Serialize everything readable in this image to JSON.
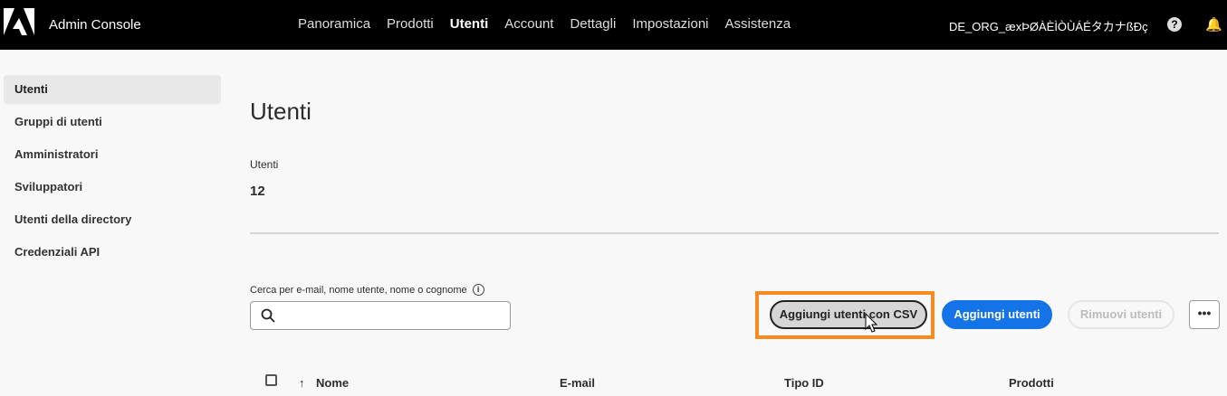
{
  "header": {
    "app_name": "Admin Console",
    "nav": [
      "Panoramica",
      "Prodotti",
      "Utenti",
      "Account",
      "Dettagli",
      "Impostazioni",
      "Assistenza"
    ],
    "active_nav": "Utenti",
    "org": "DE_ORG_æxÞØÀÈÌÒÙÁÉタカナßÐç"
  },
  "sidebar": {
    "items": [
      {
        "label": "Utenti"
      },
      {
        "label": "Gruppi di utenti"
      },
      {
        "label": "Amministratori"
      },
      {
        "label": "Sviluppatori"
      },
      {
        "label": "Utenti della directory"
      },
      {
        "label": "Credenziali API"
      }
    ]
  },
  "main": {
    "title": "Utenti",
    "stat_label": "Utenti",
    "stat_value": "12",
    "search_label": "Cerca per e-mail, nome utente, nome o cognome",
    "search_value": "",
    "buttons": {
      "csv": "Aggiungi utenti con CSV",
      "add": "Aggiungi utenti",
      "remove": "Rimuovi utenti",
      "more": "•••"
    },
    "columns": [
      "Nome",
      "E-mail",
      "Tipo ID",
      "Prodotti"
    ]
  },
  "colors": {
    "accent": "#1473e6",
    "highlight": "#f68b1f"
  }
}
